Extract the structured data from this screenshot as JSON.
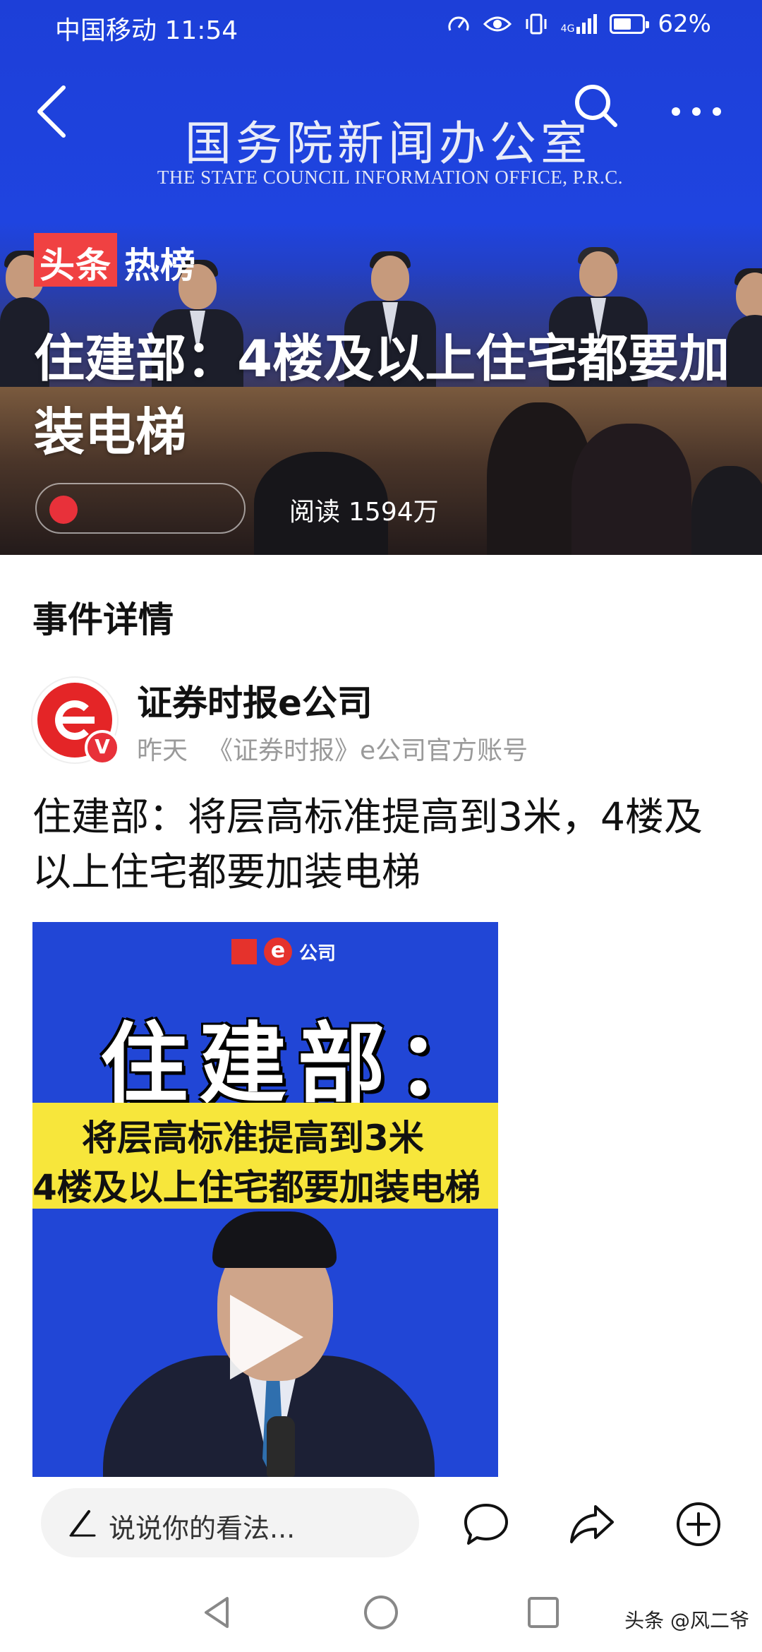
{
  "status_bar": {
    "carrier": "中国移动",
    "time": "11:54",
    "network": "4G",
    "battery_percent_text": "62%",
    "battery_level": 0.62
  },
  "hero": {
    "backdrop_title_cn": "国务院新闻办公室",
    "backdrop_title_en": "THE STATE COUNCIL INFORMATION OFFICE, P.R.C.",
    "badge_part1": "头条",
    "badge_part2": "热榜",
    "headline": "住建部：4楼及以上住宅都要加装电梯",
    "read_label": "阅读",
    "read_count": "1594万"
  },
  "section": {
    "title": "事件详情"
  },
  "article": {
    "author_name": "证券时报e公司",
    "post_time": "昨天",
    "author_desc": "《证券时报》e公司官方账号",
    "verified_mark": "V",
    "title": "住建部：将层高标准提高到3米，4楼及以上住宅都要加装电梯"
  },
  "video": {
    "logo_text": "公司",
    "logo_e": "e",
    "big_text": "住建部：",
    "line1": "将层高标准提高到3米",
    "line2": "4楼及以上住宅都要加装电梯"
  },
  "comment_bar": {
    "placeholder": "说说你的看法..."
  },
  "watermark": "头条 @风二爷",
  "colors": {
    "brand_red": "#f04142",
    "hero_blue": "#1f44e0",
    "highlight_yellow": "#f7e63b"
  },
  "icons": {
    "back": "chevron-left-icon",
    "search": "search-icon",
    "more": "more-horizontal-icon",
    "comment": "comment-icon",
    "share": "share-icon",
    "add": "plus-circle-icon",
    "pen": "pen-icon",
    "play": "play-icon"
  }
}
